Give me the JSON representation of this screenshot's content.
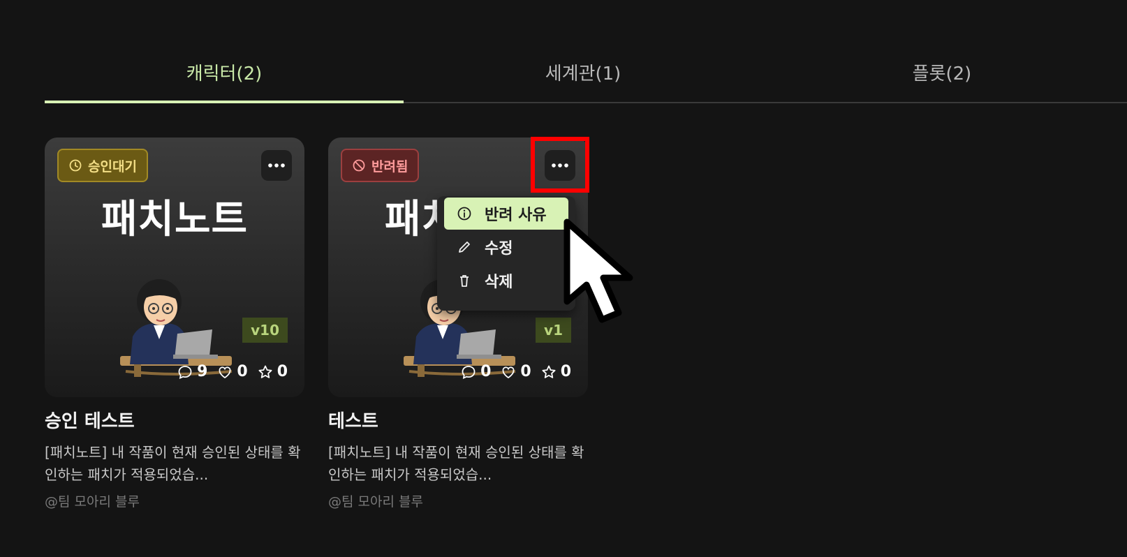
{
  "tabs": [
    {
      "label": "캐릭터(2)",
      "active": true
    },
    {
      "label": "세계관(1)",
      "active": false
    },
    {
      "label": "플롯(2)",
      "active": false
    }
  ],
  "cards": [
    {
      "badge": "승인대기",
      "badge_status": "pending",
      "thumb_title": "패치노트",
      "version": "v10",
      "comments": "9",
      "likes": "0",
      "stars": "0",
      "name": "승인 테스트",
      "description": "[패치노트] 내 작품이 현재 승인된 상태를 확인하는 패치가 적용되었습...",
      "author": "@팀 모아리 블루"
    },
    {
      "badge": "반려됨",
      "badge_status": "rejected",
      "thumb_title": "패치노트",
      "version": "v1",
      "comments": "0",
      "likes": "0",
      "stars": "0",
      "name": "테스트",
      "description": "[패치노트] 내 작품이 현재 승인된 상태를 확인하는 패치가 적용되었습...",
      "author": "@팀 모아리 블루"
    }
  ],
  "menu": {
    "items": [
      {
        "label": "반려 사유",
        "icon": "info-icon"
      },
      {
        "label": "수정",
        "icon": "pencil-icon"
      },
      {
        "label": "삭제",
        "icon": "trash-icon"
      }
    ]
  },
  "colors": {
    "accent": "#d8f2b5",
    "pending": "#a28a25",
    "rejected": "#9c3f3f",
    "highlight": "#ff0000"
  }
}
